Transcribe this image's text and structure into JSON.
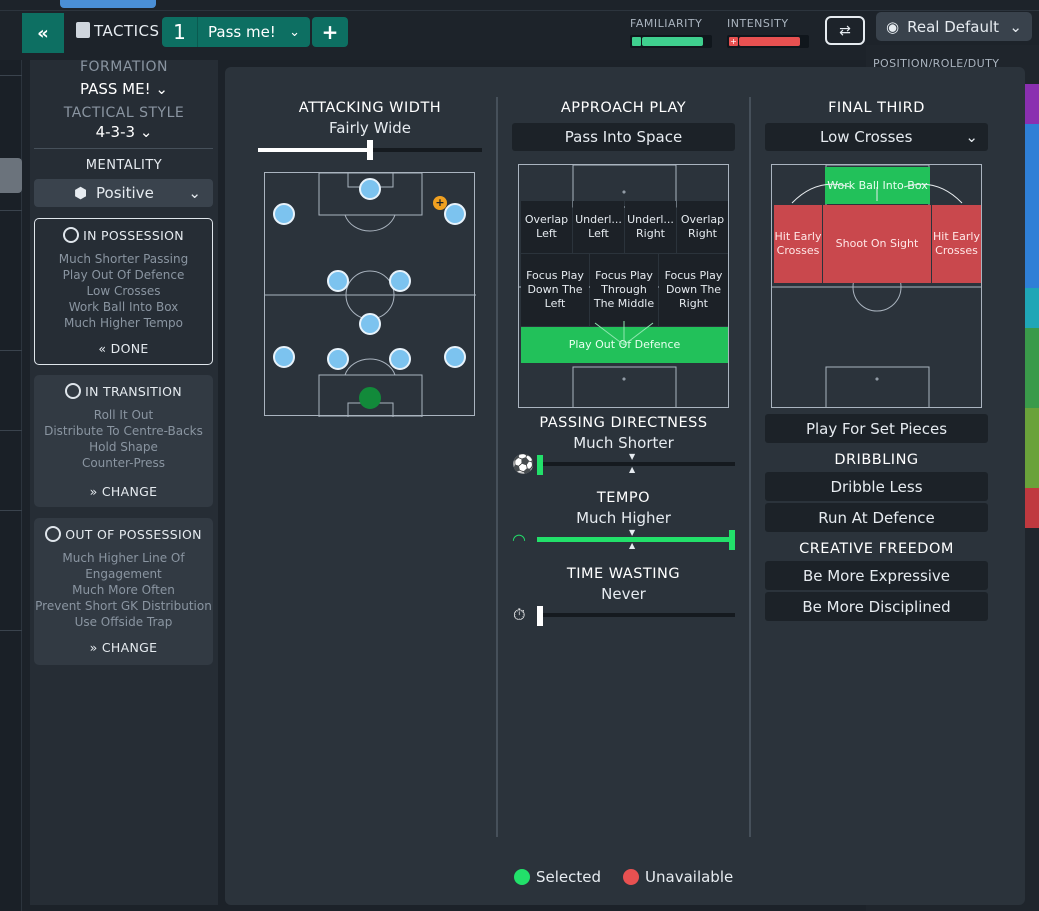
{
  "header": {
    "tactics_label": "TACTICS",
    "back_icon": "double-chevron-left-icon",
    "tactic_number": "1",
    "tactic_name": "Pass me!",
    "add_label": "+",
    "familiarity_label": "FAMILIARITY",
    "familiarity_level": 0.9,
    "intensity_label": "INTENSITY",
    "intensity_level": 0.9,
    "view_select": "Real Default",
    "colors": {
      "teal": "#0d6f62",
      "familiarity": "#3fcf8e",
      "intensity": "#e85151"
    }
  },
  "right_panel": {
    "label": "POSITION/ROLE/DUTY"
  },
  "sidebar": {
    "formation_label": "FORMATION",
    "formation_value": "PASS ME!",
    "tactical_style_label": "TACTICAL STYLE",
    "tactical_style_value": "4-3-3",
    "mentality_label": "MENTALITY",
    "mentality_value": "Positive",
    "phases": [
      {
        "title": "IN POSSESSION",
        "items": [
          "Much Shorter Passing",
          "Play Out Of Defence",
          "Low Crosses",
          "Work Ball Into Box",
          "Much Higher Tempo"
        ],
        "button": "DONE"
      },
      {
        "title": "IN TRANSITION",
        "items": [
          "Roll It Out",
          "Distribute To Centre-Backs",
          "Hold Shape",
          "Counter-Press"
        ],
        "button": "CHANGE"
      },
      {
        "title": "OUT OF POSSESSION",
        "items": [
          "Much Higher Line Of",
          "Engagement",
          "Much More Often",
          "Prevent Short GK Distribution",
          "Use Offside Trap"
        ],
        "button": "CHANGE"
      }
    ]
  },
  "attacking_width": {
    "title": "ATTACKING WIDTH",
    "value": "Fairly Wide",
    "level": 0.5
  },
  "approach_play": {
    "title": "APPROACH PLAY",
    "selected": "Pass Into Space",
    "zones_row1": [
      "Overlap Left",
      "Underl... Left",
      "Underl... Right",
      "Overlap Right"
    ],
    "zones_row2": [
      "Focus Play Down The Left",
      "Focus Play Through The Middle",
      "Focus Play Down The Right"
    ],
    "zone_selected": "Play Out Of Defence"
  },
  "passing_directness": {
    "title": "PASSING DIRECTNESS",
    "value": "Much Shorter",
    "level": 0.0
  },
  "tempo": {
    "title": "TEMPO",
    "value": "Much Higher",
    "level": 1.0
  },
  "time_wasting": {
    "title": "TIME WASTING",
    "value": "Never",
    "level": 0.0
  },
  "final_third": {
    "title": "FINAL THIRD",
    "selected": "Low Crosses",
    "zone_top": "Work Ball Into Box",
    "zone_left": "Hit Early Crosses",
    "zone_center": "Shoot On Sight",
    "zone_right": "Hit Early Crosses",
    "set_pieces": "Play For Set Pieces"
  },
  "dribbling": {
    "title": "DRIBBLING",
    "options": [
      "Dribble Less",
      "Run At Defence"
    ]
  },
  "creative_freedom": {
    "title": "CREATIVE FREEDOM",
    "options": [
      "Be More Expressive",
      "Be More Disciplined"
    ]
  },
  "legend": {
    "selected": "Selected",
    "unavailable": "Unavailable",
    "selected_color": "#22e06a",
    "unavailable_color": "#e85151"
  }
}
